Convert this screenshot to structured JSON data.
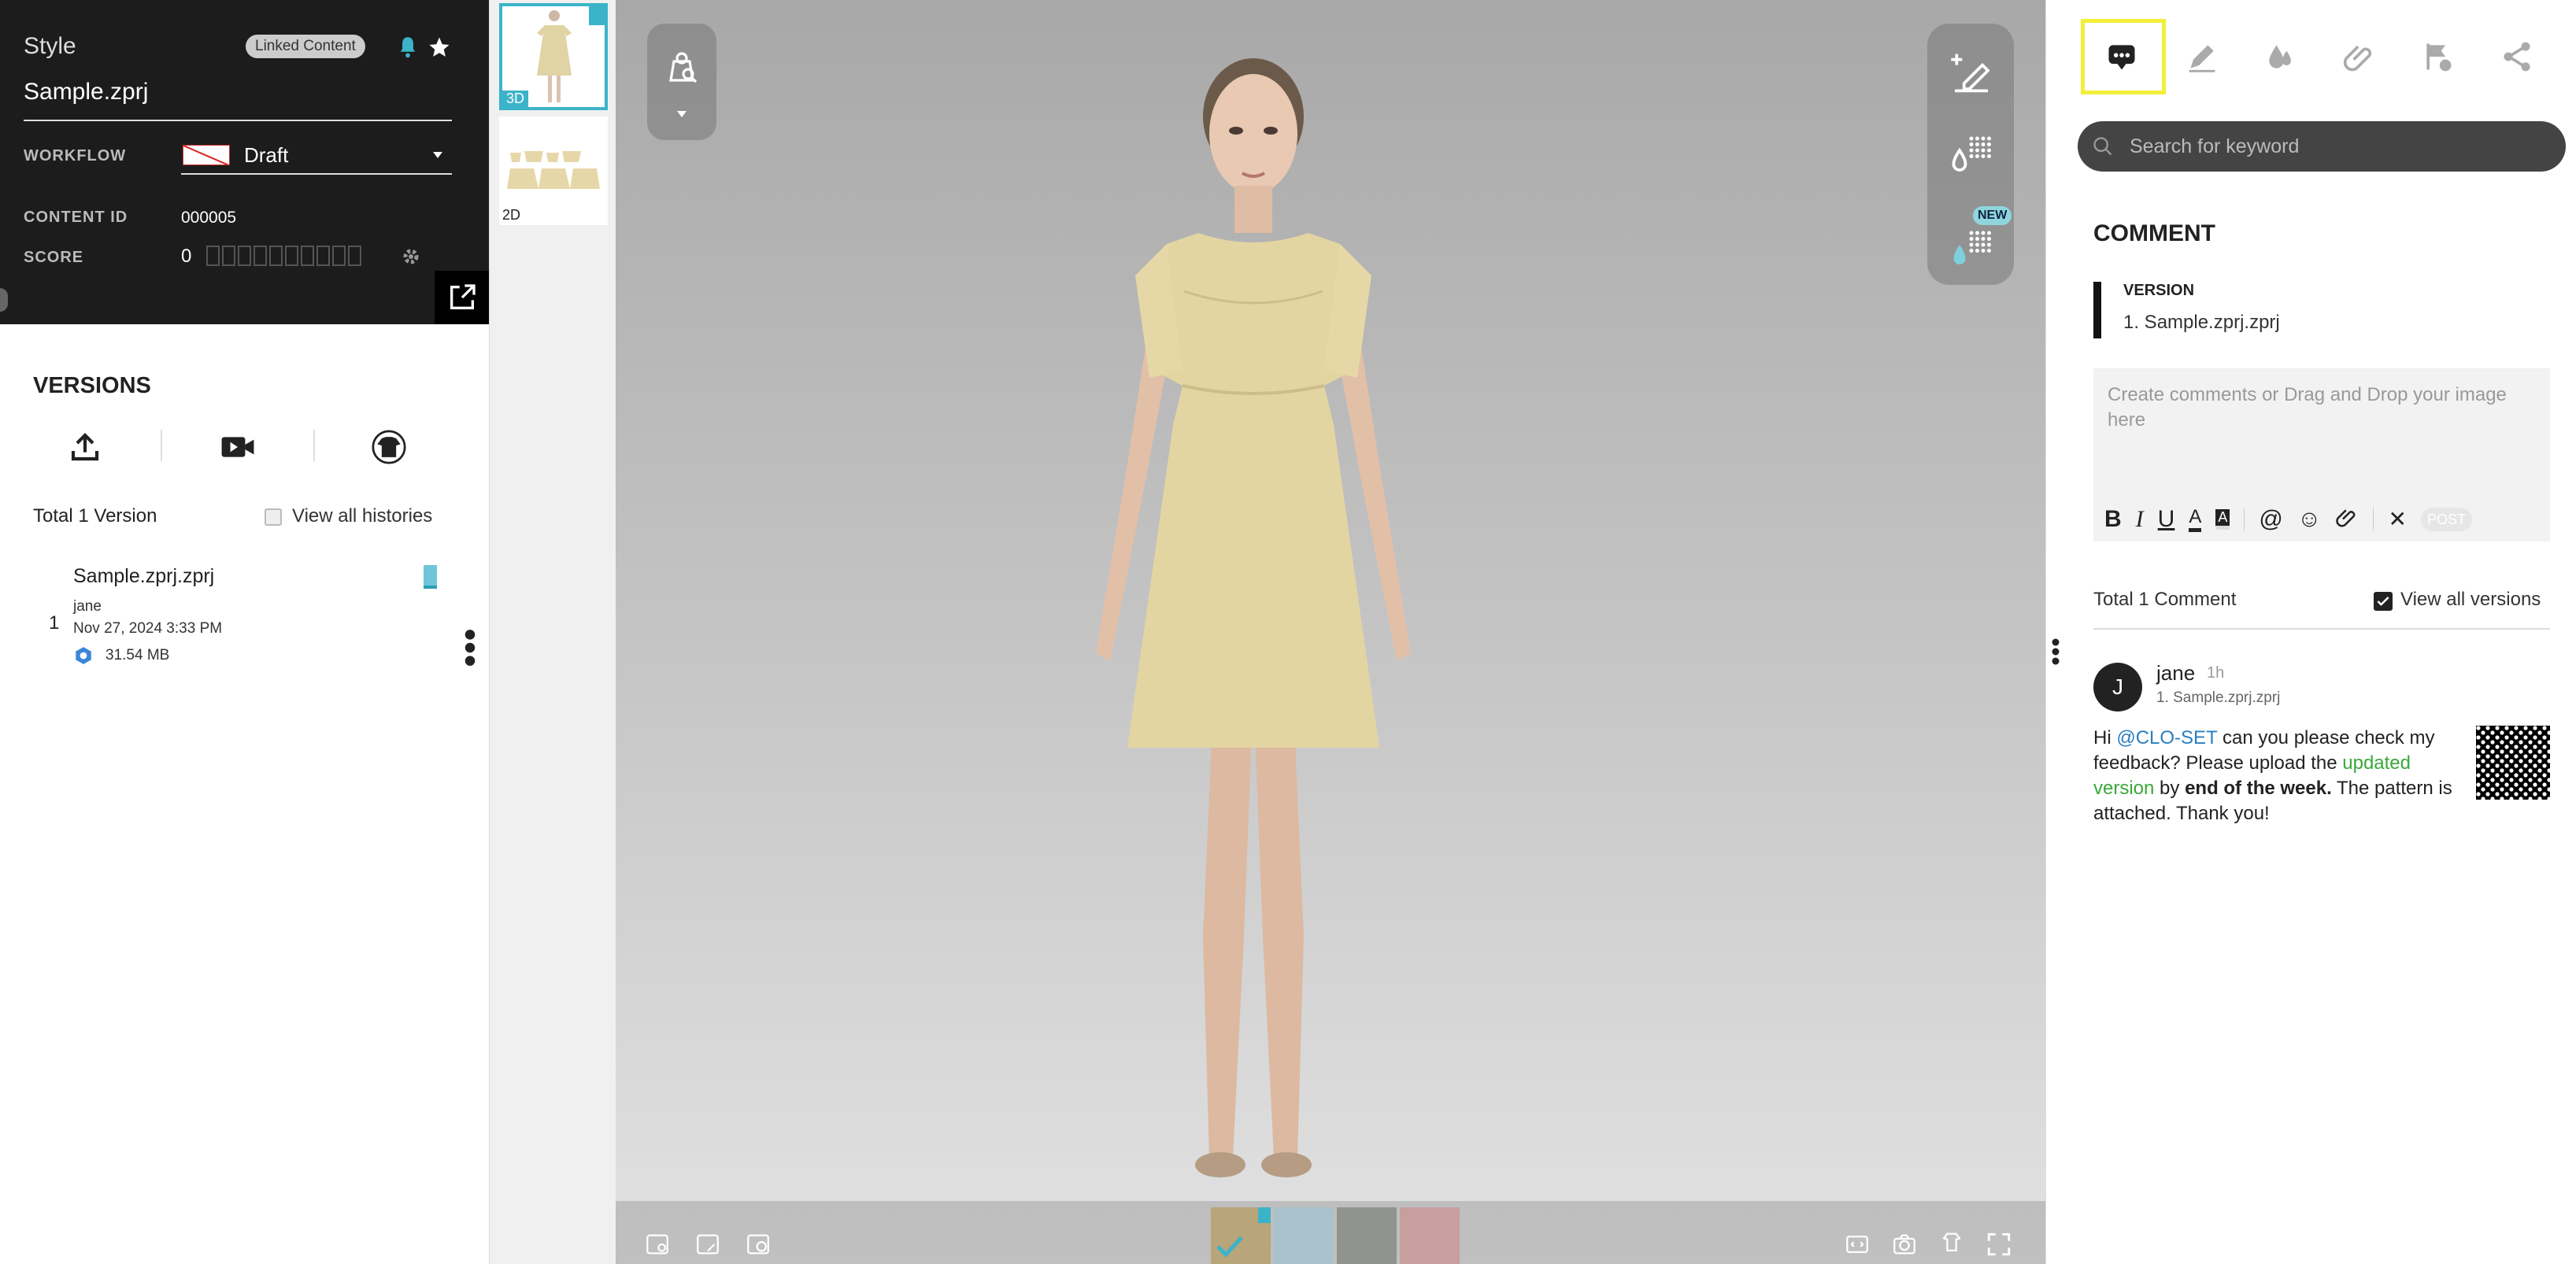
{
  "info": {
    "section_label": "Style",
    "linked_badge": "Linked Content",
    "file_name": "Sample.zprj",
    "workflow_label": "WORKFLOW",
    "workflow_value": "Draft",
    "content_id_label": "CONTENT ID",
    "content_id_value": "000005",
    "score_label": "SCORE",
    "score_value": "0"
  },
  "versions": {
    "title": "VERSIONS",
    "total": "Total 1 Version",
    "view_all": "View all histories",
    "item": {
      "index": "1",
      "name": "Sample.zprj.zprj",
      "user": "jane",
      "date": "Nov 27, 2024 3:33 PM",
      "size": "31.54 MB"
    }
  },
  "thumbs": [
    {
      "label": "3D"
    },
    {
      "label": "2D"
    }
  ],
  "viewer": {
    "new_badge": "NEW",
    "colorways": [
      "beige",
      "light-blue",
      "grey",
      "pink"
    ]
  },
  "right": {
    "search_placeholder": "Search for keyword",
    "comment_title": "COMMENT",
    "version_label": "VERSION",
    "version_value": "1. Sample.zprj.zprj",
    "editor_placeholder": "Create comments or Drag and Drop your image here",
    "post_label": "POST",
    "total": "Total 1 Comment",
    "view_all_versions": "View all versions",
    "comment": {
      "avatar": "J",
      "user": "jane",
      "time": "1h",
      "version": "1. Sample.zprj.zprj",
      "t1": "Hi ",
      "mention": "@CLO-SET",
      "t2": "  can you please check my feedback? Please upload the ",
      "link": "updated version",
      "t3": " by ",
      "bold": "end of the week.",
      "t4": " The pattern is attached. Thank you!"
    }
  },
  "colors": {
    "accent": "#3bb3c8",
    "highlight": "#f2ef3a",
    "mention": "#2a7fbf",
    "link": "#3aa83a"
  }
}
